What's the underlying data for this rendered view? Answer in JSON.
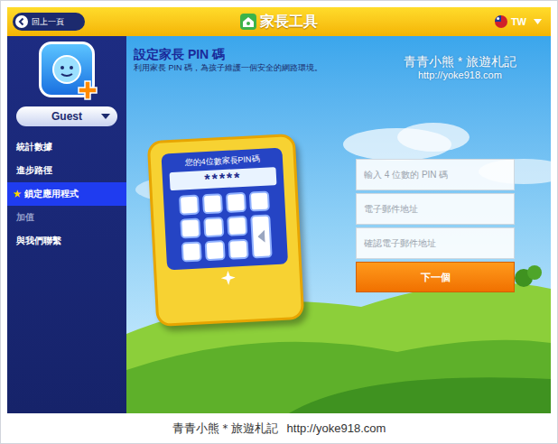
{
  "header": {
    "back": "回上一頁",
    "title": "家長工具",
    "language": "TW"
  },
  "sidebar": {
    "user": "Guest",
    "items": [
      {
        "label": "統計數據",
        "selected": false,
        "disabled": false
      },
      {
        "label": "進步路徑",
        "selected": false,
        "disabled": false
      },
      {
        "label": "鎖定應用程式",
        "icon": "★",
        "selected": true,
        "disabled": false
      },
      {
        "label": "加值",
        "selected": false,
        "disabled": true
      },
      {
        "label": "與我們聯繫",
        "selected": false,
        "disabled": false
      }
    ]
  },
  "main": {
    "title": "設定家長 PIN 碼",
    "subtitle": "利用家長 PIN 碼，為孩子維護一個安全的網路環境。"
  },
  "device": {
    "label": "您的4位數家長PIN碼",
    "pin": "*****"
  },
  "form": {
    "fields": [
      {
        "placeholder": "輸入 4 位數的 PIN 碼"
      },
      {
        "placeholder": "電子郵件地址"
      },
      {
        "placeholder": "確認電子郵件地址"
      }
    ],
    "button": "下一個"
  },
  "watermark": {
    "name": "青青小熊 * 旅遊札記",
    "url": "http://yoke918.com"
  },
  "caption": {
    "name": "青青小熊＊旅遊札記",
    "url": "http://yoke918.com"
  }
}
